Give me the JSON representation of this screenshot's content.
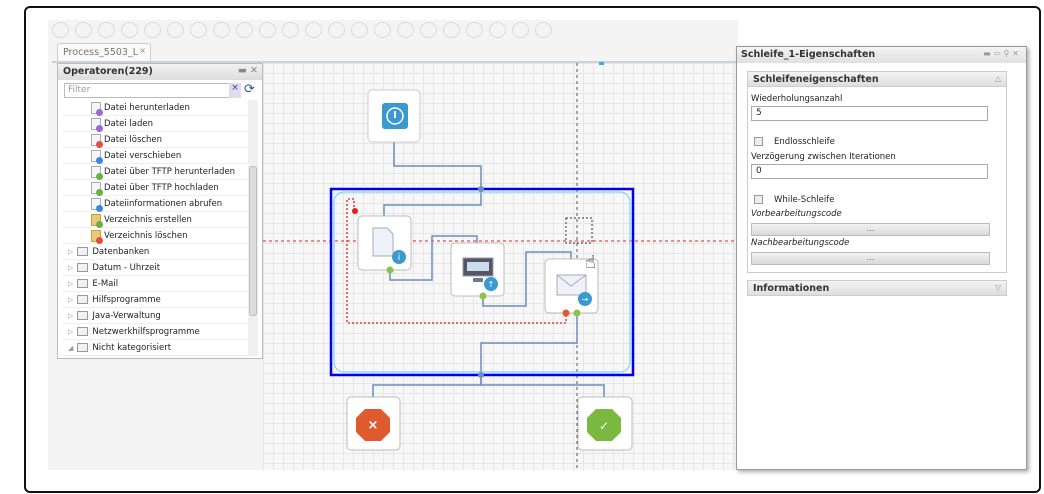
{
  "toolbar": {
    "icons": [
      "save-icon",
      "delete-icon",
      "check-icon",
      "cancel-icon",
      "run-icon",
      "run-debug-icon",
      "wand-icon",
      "copy-icon",
      "paste-icon",
      "redo-icon",
      "undo-icon",
      "document-icon",
      "crop-icon",
      "zoom-in-icon",
      "zoom-out-icon",
      "fit-icon",
      "hand-icon",
      "search-clear-icon",
      "tag-icon",
      "tag-check-icon",
      "export-icon",
      "help-icon"
    ]
  },
  "tabs": [
    {
      "label": "Process_5503_L",
      "close": "×"
    }
  ],
  "operators": {
    "title": "Operatoren(229)",
    "filter_placeholder": "Filter",
    "clear": "×",
    "items": [
      {
        "label": "Datei herunterladen",
        "type": "file",
        "badge": "#9a6ad0"
      },
      {
        "label": "Datei laden",
        "type": "file",
        "badge": "#9a6ad0"
      },
      {
        "label": "Datei löschen",
        "type": "file",
        "badge": "#e0503a"
      },
      {
        "label": "Datei verschieben",
        "type": "file",
        "badge": "#3a8ad0"
      },
      {
        "label": "Datei über TFTP herunterladen",
        "type": "file",
        "badge": "#6ab040"
      },
      {
        "label": "Datei über TFTP hochladen",
        "type": "file",
        "badge": "#6ab040"
      },
      {
        "label": "Dateiinformationen abrufen",
        "type": "file",
        "badge": "#3a8ad0"
      },
      {
        "label": "Verzeichnis erstellen",
        "type": "dir",
        "badge": "#6ab040"
      },
      {
        "label": "Verzeichnis löschen",
        "type": "dir",
        "badge": "#e0503a"
      }
    ],
    "categories": [
      "Datenbanken",
      "Datum - Uhrzeit",
      "E-Mail",
      "Hilfsprogramme",
      "Java-Verwaltung",
      "Netzwerkhilfsprogramme",
      "Nicht kategorisiert"
    ]
  },
  "properties": {
    "title": "Schleife_1-Eigenschaften",
    "section1": "Schleifeneigenschaften",
    "repeat_label": "Wiederholungsanzahl",
    "repeat_value": "5",
    "endless_label": "Endlosschleife",
    "endless_checked": false,
    "delay_label": "Verzögerung zwischen Iterationen",
    "delay_value": "0",
    "while_label": "While-Schleife",
    "while_checked": false,
    "pre_label": "Vorbearbeitungscode",
    "pre_button": "...",
    "post_label": "Nachbearbeitungscode",
    "post_button": "...",
    "section2": "Informationen"
  },
  "colors": {
    "loop_border": "#0000ee",
    "connector": "#6c8ebf",
    "error_path": "#e02020",
    "start": "#3a9ad0",
    "error_end": "#e05a30",
    "success_end": "#7ab840"
  }
}
